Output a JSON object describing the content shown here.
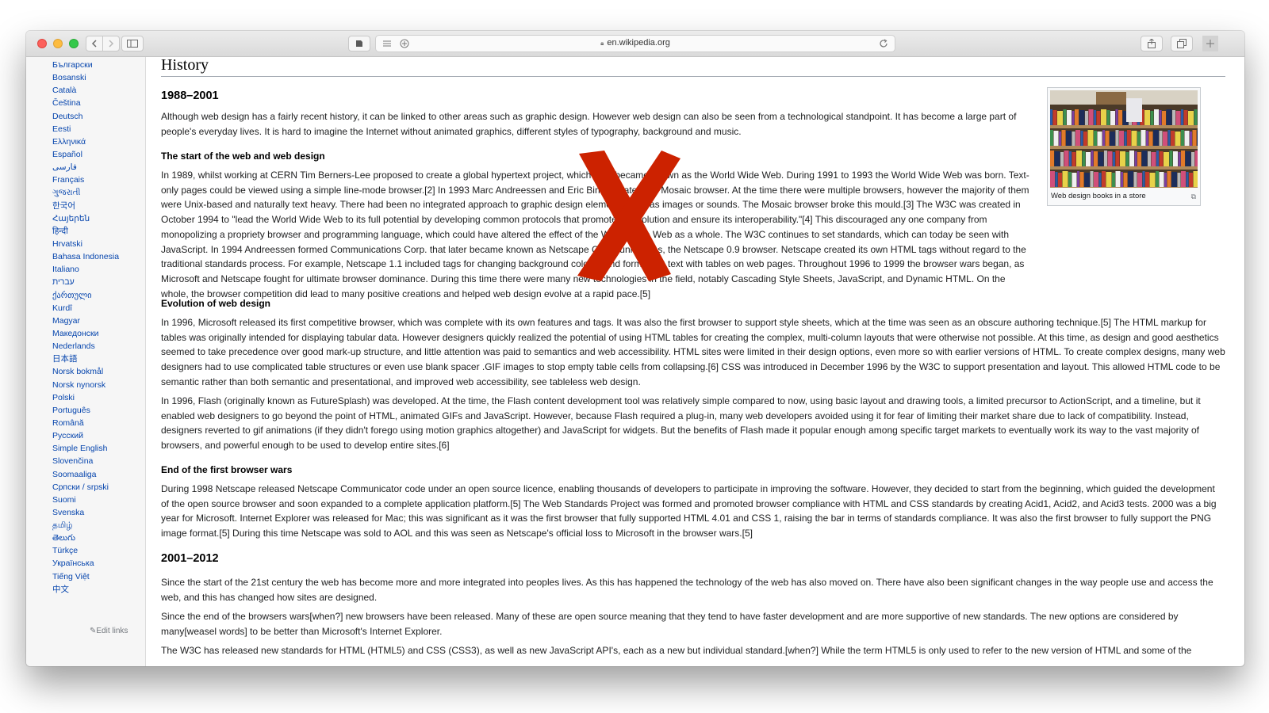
{
  "browser": {
    "url": "en.wikipedia.org",
    "icons": [
      "back-icon",
      "forward-icon",
      "sidebar-icon",
      "privacy-icon",
      "reader-icon",
      "add-icon",
      "lock-icon",
      "reload-icon",
      "share-icon",
      "tabs-icon",
      "new-tab-icon"
    ]
  },
  "sidebar": {
    "languages": [
      "Български",
      "Bosanski",
      "Català",
      "Čeština",
      "Deutsch",
      "Eesti",
      "Ελληνικά",
      "Español",
      "فارسی",
      "Français",
      "ગુજરાતી",
      "한국어",
      "Հայերեն",
      "हिन्दी",
      "Hrvatski",
      "Bahasa Indonesia",
      "Italiano",
      "עברית",
      "ქართული",
      "Kurdî",
      "Magyar",
      "Македонски",
      "Nederlands",
      "日本語",
      "Norsk bokmål",
      "Norsk nynorsk",
      "Polski",
      "Português",
      "Română",
      "Русский",
      "Simple English",
      "Slovenčina",
      "Soomaaliga",
      "Српски / srpski",
      "Suomi",
      "Svenska",
      "தமிழ்",
      "తెలుగు",
      "Türkçe",
      "Українська",
      "Tiếng Việt",
      "中文"
    ],
    "edit_links": "Edit links"
  },
  "article": {
    "section_title": "History",
    "h_1988": "1988–2001",
    "intro": "Although web design has a fairly recent history, it can be linked to other areas such as graphic design. However web design can also be seen from a technological standpoint. It has become a large part of people's everyday lives. It is hard to imagine the Internet without animated graphics, different styles of typography, background and music.",
    "h_start": "The start of the web and web design",
    "start_p": "In 1989, whilst working at CERN Tim Berners-Lee proposed to create a global hypertext project, which later became known as the World Wide Web. During 1991 to 1993 the World Wide Web was born. Text-only pages could be viewed using a simple line-mode browser.[2] In 1993 Marc Andreessen and Eric Bina, created the Mosaic browser. At the time there were multiple browsers, however the majority of them were Unix-based and naturally text heavy. There had been no integrated approach to graphic design elements such as images or sounds. The Mosaic browser broke this mould.[3] The W3C was created in October 1994 to \"lead the World Wide Web to its full potential by developing common protocols that promote its evolution and ensure its interoperability.\"[4] This discouraged any one company from monopolizing a propriety browser and programming language, which could have altered the effect of the World Wide Web as a whole. The W3C continues to set standards, which can today be seen with JavaScript. In 1994 Andreessen formed Communications Corp. that later became known as Netscape Communications, the Netscape 0.9 browser. Netscape created its own HTML tags without regard to the traditional standards process. For example, Netscape 1.1 included tags for changing background colours and formatting text with tables on web pages. Throughout 1996 to 1999 the browser wars began, as Microsoft and Netscape fought for ultimate browser dominance. During this time there were many new technologies in the field, notably Cascading Style Sheets, JavaScript, and Dynamic HTML. On the whole, the browser competition did lead to many positive creations and helped web design evolve at a rapid pace.[5]",
    "h_evolution": "Evolution of web design",
    "evo_p1": "In 1996, Microsoft released its first competitive browser, which was complete with its own features and tags. It was also the first browser to support style sheets, which at the time was seen as an obscure authoring technique.[5] The HTML markup for tables was originally intended for displaying tabular data. However designers quickly realized the potential of using HTML tables for creating the complex, multi-column layouts that were otherwise not possible. At this time, as design and good aesthetics seemed to take precedence over good mark-up structure, and little attention was paid to semantics and web accessibility. HTML sites were limited in their design options, even more so with earlier versions of HTML. To create complex designs, many web designers had to use complicated table structures or even use blank spacer .GIF images to stop empty table cells from collapsing.[6] CSS was introduced in December 1996 by the W3C to support presentation and layout. This allowed HTML code to be semantic rather than both semantic and presentational, and improved web accessibility, see tableless web design.",
    "evo_p2": "In 1996, Flash (originally known as FutureSplash) was developed. At the time, the Flash content development tool was relatively simple compared to now, using basic layout and drawing tools, a limited precursor to ActionScript, and a timeline, but it enabled web designers to go beyond the point of HTML, animated GIFs and JavaScript. However, because Flash required a plug-in, many web developers avoided using it for fear of limiting their market share due to lack of compatibility. Instead, designers reverted to gif animations (if they didn't forego using motion graphics altogether) and JavaScript for widgets. But the benefits of Flash made it popular enough among specific target markets to eventually work its way to the vast majority of browsers, and powerful enough to be used to develop entire sites.[6]",
    "h_end": "End of the first browser wars",
    "end_p": "During 1998 Netscape released Netscape Communicator code under an open source licence, enabling thousands of developers to participate in improving the software. However, they decided to start from the beginning, which guided the development of the open source browser and soon expanded to a complete application platform.[5] The Web Standards Project was formed and promoted browser compliance with HTML and CSS standards by creating Acid1, Acid2, and Acid3 tests. 2000 was a big year for Microsoft. Internet Explorer was released for Mac; this was significant as it was the first browser that fully supported HTML 4.01 and CSS 1, raising the bar in terms of standards compliance. It was also the first browser to fully support the PNG image format.[5] During this time Netscape was sold to AOL and this was seen as Netscape's official loss to Microsoft in the browser wars.[5]",
    "h_2001": "2001–2012",
    "p2001_1": "Since the start of the 21st century the web has become more and more integrated into peoples lives. As this has happened the technology of the web has also moved on. There have also been significant changes in the way people use and access the web, and this has changed how sites are designed.",
    "p2001_2": "Since the end of the browsers wars[when?] new browsers have been released. Many of these are open source meaning that they tend to have faster development and are more supportive of new standards. The new options are considered by many[weasel words] to be better than Microsoft's Internet Explorer.",
    "p2001_3": "The W3C has released new standards for HTML (HTML5) and CSS (CSS3), as well as new JavaScript API's, each as a new but individual standard.[when?] While the term HTML5 is only used to refer to the new version of HTML and some of the"
  },
  "figure": {
    "caption": "Web design books in a store",
    "enlarge_icon": "enlarge-icon"
  },
  "overlay": {
    "icon": "red-x-mark-icon",
    "color": "#cc2200"
  },
  "colors": {
    "link": "#0645ad",
    "redlink": "#dd3333",
    "text": "#202122"
  }
}
